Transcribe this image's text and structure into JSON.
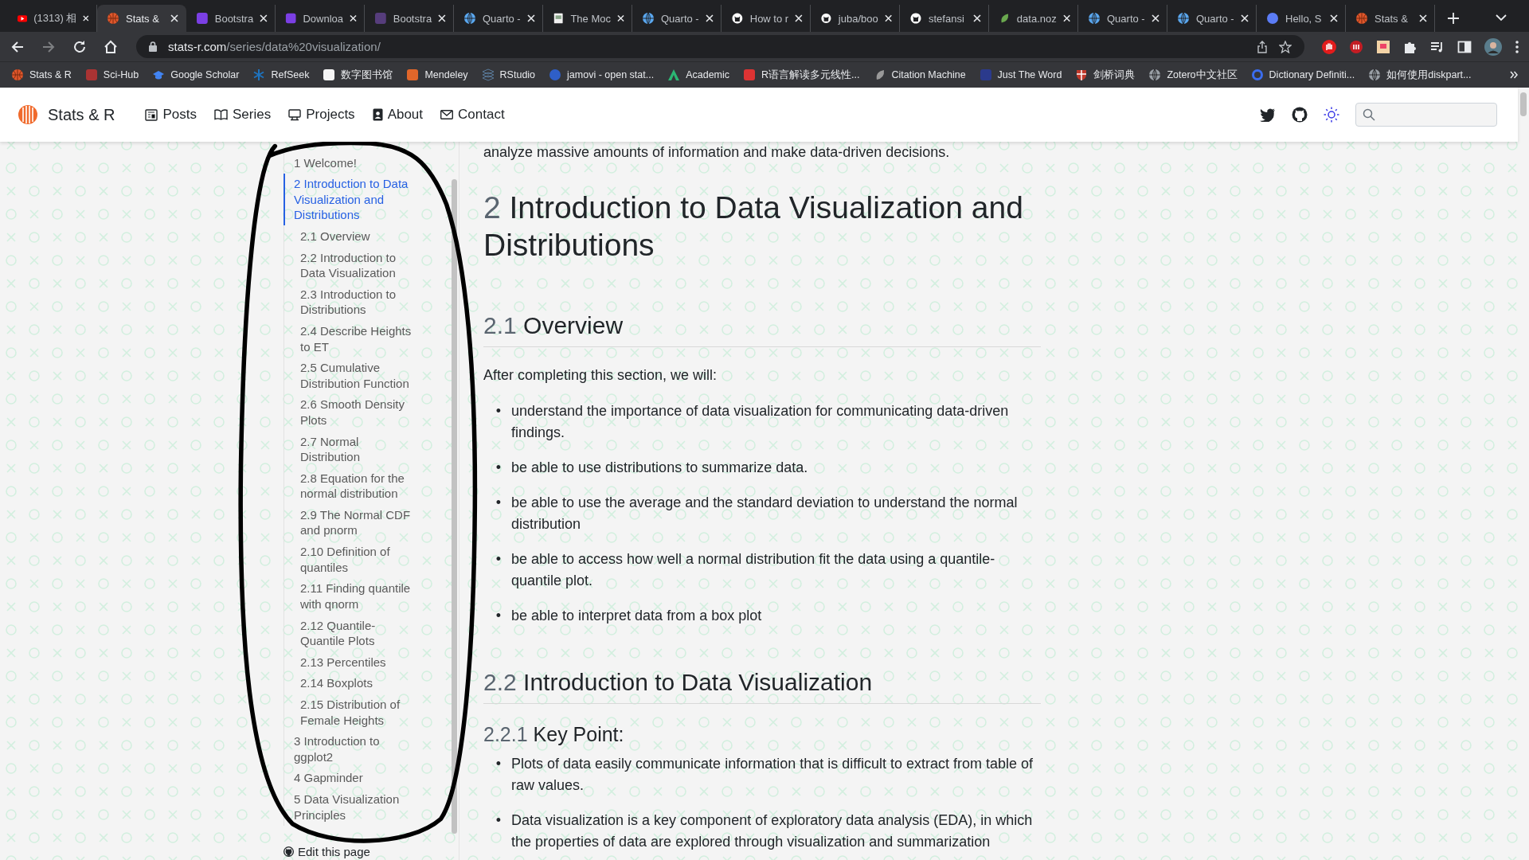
{
  "browser": {
    "tabs": [
      {
        "title": "(1313) 相",
        "selected": false
      },
      {
        "title": "Stats &",
        "selected": true
      },
      {
        "title": "Bootstra",
        "selected": false
      },
      {
        "title": "Downloa",
        "selected": false
      },
      {
        "title": "Bootstra",
        "selected": false
      },
      {
        "title": "Quarto -",
        "selected": false
      },
      {
        "title": "The Moc",
        "selected": false
      },
      {
        "title": "Quarto -",
        "selected": false
      },
      {
        "title": "How to r",
        "selected": false
      },
      {
        "title": "juba/boo",
        "selected": false
      },
      {
        "title": "stefansi",
        "selected": false
      },
      {
        "title": "data.noz",
        "selected": false
      },
      {
        "title": "Quarto -",
        "selected": false
      },
      {
        "title": "Quarto -",
        "selected": false
      },
      {
        "title": "Hello, S",
        "selected": false
      },
      {
        "title": "Stats &",
        "selected": false
      }
    ],
    "address": {
      "domain": "stats-r.com",
      "path": "/series/data%20visualization/"
    },
    "bookmarks": [
      "Stats & R",
      "Sci-Hub",
      "Google Scholar",
      "RefSeek",
      "数字图书馆",
      "Mendeley",
      "RStudio",
      "jamovi - open stat...",
      "Academic",
      "R语言解读多元线性...",
      "Citation Machine",
      "Just The Word",
      "剑桥词典",
      "Zotero中文社区",
      "Dictionary Definiti...",
      "如何使用diskpart..."
    ]
  },
  "site": {
    "brand": "Stats & R",
    "nav": [
      "Posts",
      "Series",
      "Projects",
      "About",
      "Contact"
    ]
  },
  "sidebar": {
    "toc": [
      {
        "label": "1 Welcome!",
        "selected": false
      },
      {
        "label": "2 Introduction to Data Visualization and Distributions",
        "selected": true,
        "children": [
          {
            "label": "2.1 Overview",
            "selected": false
          },
          {
            "label": "2.2 Introduction to Data Visualization",
            "selected": false
          },
          {
            "label": "2.3 Introduction to Distributions",
            "selected": false
          },
          {
            "label": "2.4 Describe Heights to ET",
            "selected": false
          },
          {
            "label": "2.5 Cumulative Distribution Function",
            "selected": false
          },
          {
            "label": "2.6 Smooth Density Plots",
            "selected": false
          },
          {
            "label": "2.7 Normal Distribution",
            "selected": false
          },
          {
            "label": "2.8 Equation for the normal distribution",
            "selected": false
          },
          {
            "label": "2.9 The Normal CDF and pnorm",
            "selected": false
          },
          {
            "label": "2.10 Definition of quantiles",
            "selected": false
          },
          {
            "label": "2.11 Finding quantile with qnorm",
            "selected": false
          },
          {
            "label": "2.12 Quantile-Quantile Plots",
            "selected": false
          },
          {
            "label": "2.13 Percentiles",
            "selected": false
          },
          {
            "label": "2.14 Boxplots",
            "selected": false
          },
          {
            "label": "2.15 Distribution of Female Heights",
            "selected": false
          }
        ]
      },
      {
        "label": "3 Introduction to ggplot2",
        "selected": false
      },
      {
        "label": "4 Gapminder",
        "selected": false
      },
      {
        "label": "5 Data Visualization Principles",
        "selected": false
      }
    ],
    "edit_link": "Edit this page"
  },
  "content": {
    "blocks": [
      {
        "kind": "p",
        "text": "analyze massive amounts of information and make data-driven decisions."
      },
      {
        "kind": "h1",
        "number": "2",
        "text": "Introduction to Data Visualization and Distributions"
      },
      {
        "kind": "h2",
        "number": "2.1",
        "text": "Overview"
      },
      {
        "kind": "p",
        "text": "After completing this section, we will:"
      },
      {
        "kind": "ul",
        "marker": "•",
        "items": [
          "understand the importance of data visualization for communicating data-driven findings.",
          "be able to use distributions to summarize data.",
          "be able to use the average and the standard deviation to understand the normal distribution",
          "be able to access how well a normal distribution fit the data using a quantile-quantile plot.",
          "be able to interpret data from a box plot"
        ]
      },
      {
        "kind": "h2",
        "number": "2.2",
        "text": "Introduction to Data Visualization"
      },
      {
        "kind": "h3",
        "number": "2.2.1",
        "text": "Key Point:"
      },
      {
        "kind": "ul",
        "marker": "•",
        "items": [
          "Plots of data easily communicate information that is difficult to extract from table of raw values.",
          "Data visualization is a key component of exploratory data analysis (EDA), in which the properties of data are explored through visualization and summarization"
        ]
      }
    ]
  }
}
